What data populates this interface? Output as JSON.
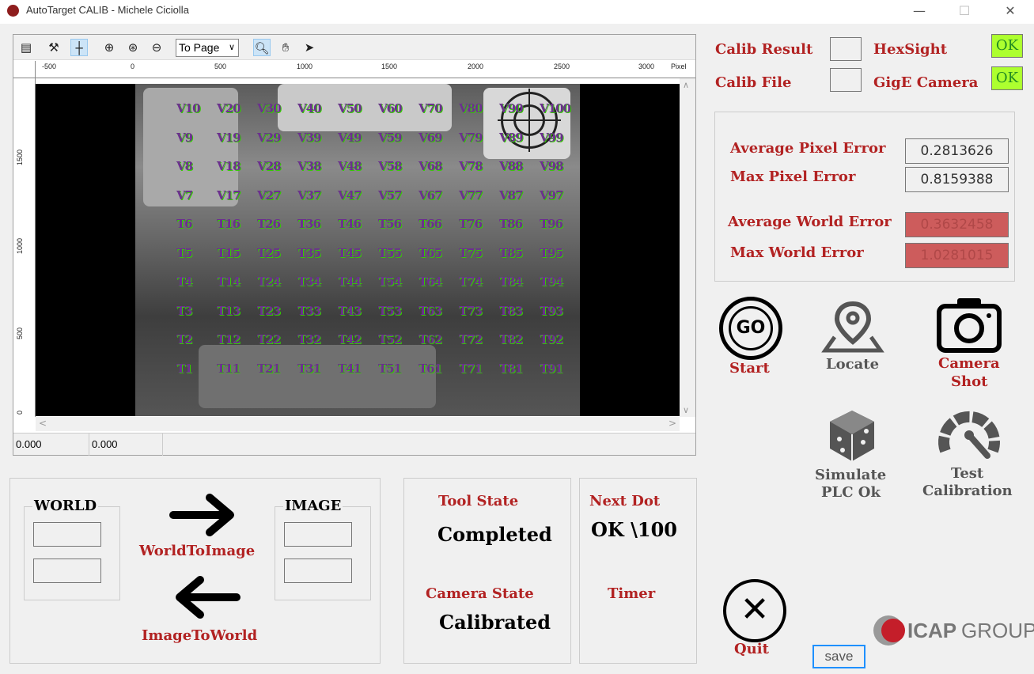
{
  "window": {
    "title": "AutoTarget CALIB - Michele Ciciolla",
    "minimize": "—",
    "maximize": "☐",
    "close": "✕"
  },
  "viewer": {
    "zoom_select": "To Page",
    "ruler_unit": "Pixel",
    "ruler_h_ticks": [
      "-500",
      "0",
      "500",
      "1000",
      "1500",
      "2000",
      "2500",
      "3000"
    ],
    "ruler_v_ticks": [
      "1500",
      "1000",
      "500",
      "0"
    ],
    "status_x": "0.000",
    "status_y": "0.000",
    "targets": [
      [
        "V10",
        "V20",
        "V30",
        "V40",
        "V50",
        "V60",
        "V70",
        "V80",
        "V90",
        "V100"
      ],
      [
        "V9",
        "V19",
        "V29",
        "V39",
        "V49",
        "V59",
        "V69",
        "V79",
        "V89",
        "V99"
      ],
      [
        "V8",
        "V18",
        "V28",
        "V38",
        "V48",
        "V58",
        "V68",
        "V78",
        "V88",
        "V98"
      ],
      [
        "V7",
        "V17",
        "V27",
        "V37",
        "V47",
        "V57",
        "V67",
        "V77",
        "V87",
        "V97"
      ],
      [
        "T6",
        "T16",
        "T26",
        "T36",
        "T46",
        "T56",
        "T66",
        "T76",
        "T86",
        "T96"
      ],
      [
        "T5",
        "T15",
        "T25",
        "T35",
        "T45",
        "T55",
        "T65",
        "T75",
        "T85",
        "T95"
      ],
      [
        "T4",
        "T14",
        "T24",
        "T34",
        "T44",
        "T54",
        "T64",
        "T74",
        "T84",
        "T94"
      ],
      [
        "T3",
        "T13",
        "T23",
        "T33",
        "T43",
        "T53",
        "T63",
        "T73",
        "T83",
        "T93"
      ],
      [
        "T2",
        "T12",
        "T22",
        "T32",
        "T42",
        "T52",
        "T62",
        "T72",
        "T82",
        "T92"
      ],
      [
        "T1",
        "T11",
        "T21",
        "T31",
        "T41",
        "T51",
        "T61",
        "T71",
        "T81",
        "T91"
      ]
    ]
  },
  "status": {
    "calib_result_label": "Calib Result",
    "calib_file_label": "Calib File",
    "hexsight_label": "HexSight",
    "hexsight_value": "OK",
    "gige_label": "GigE Camera",
    "gige_value": "OK"
  },
  "errors": {
    "avg_pixel_label": "Average Pixel Error",
    "avg_pixel_value": "0.2813626",
    "max_pixel_label": "Max Pixel Error",
    "max_pixel_value": "0.8159388",
    "avg_world_label": "Average World Error",
    "avg_world_value": "0.3632458",
    "max_world_label": "Max World Error",
    "max_world_value": "1.0281015"
  },
  "actions": {
    "start": "Start",
    "start_icon_text": "GO",
    "locate": "Locate",
    "camera_shot_1": "Camera",
    "camera_shot_2": "Shot",
    "simulate_1": "Simulate",
    "simulate_2": "PLC Ok",
    "test_1": "Test",
    "test_2": "Calibration",
    "quit": "Quit",
    "save": "save"
  },
  "conversion": {
    "world_label": "WORLD",
    "image_label": "IMAGE",
    "world_to_image": "WorldToImage",
    "image_to_world": "ImageToWorld"
  },
  "state": {
    "tool_state_label": "Tool State",
    "tool_state_value": "Completed",
    "camera_state_label": "Camera State",
    "camera_state_value": "Calibrated",
    "next_dot_label": "Next Dot",
    "next_dot_value": "OK \\100",
    "timer_label": "Timer"
  },
  "logo": {
    "icap": "ICAP",
    "group": "GROUP"
  },
  "colors": {
    "accent": "#b22222",
    "ok": "#adff2f",
    "bad": "#cd5c5c"
  }
}
